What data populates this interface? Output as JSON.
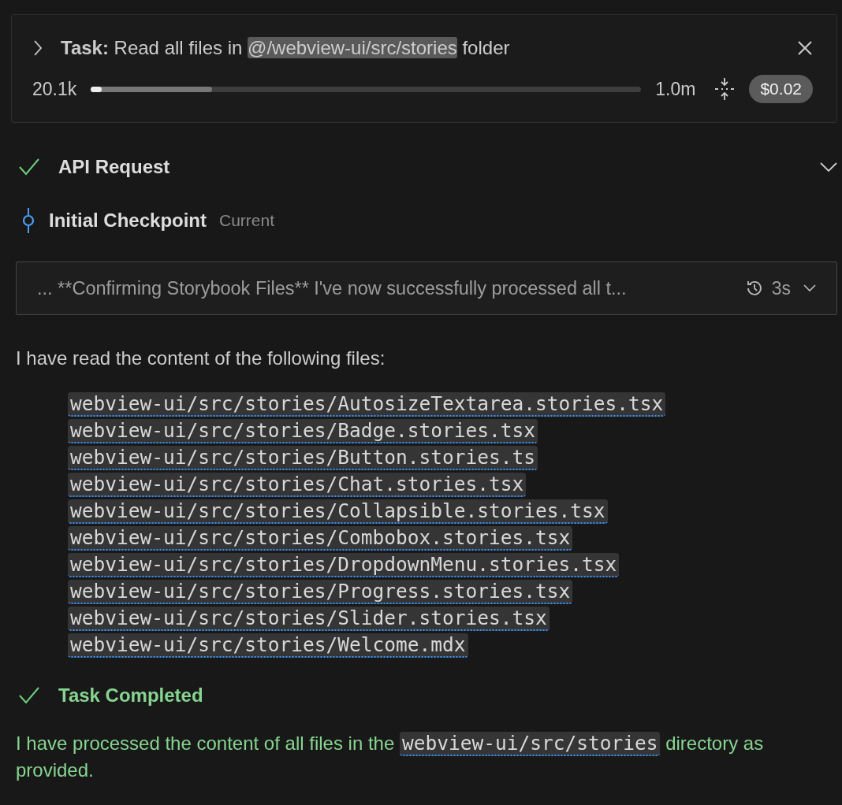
{
  "task": {
    "expanded": false,
    "label": "Task:",
    "before": "Read all files in ",
    "mention": "@/webview-ui/src/stories",
    "after": " folder",
    "tokens": "20.1k",
    "context_bar": {
      "level": 0.02,
      "buffer": {
        "level": 0.22
      }
    },
    "context_window": "1.0m",
    "cost": "$0.02"
  },
  "api_request": {
    "title": "API Request",
    "done": true,
    "expanded": false
  },
  "checkpoint": {
    "title": "Initial Checkpoint",
    "status": "Current"
  },
  "thinking": {
    "text": "... **Confirming Storybook Files** I've now successfully processed all t...",
    "duration": "3s",
    "expanded": false
  },
  "intro": "I have read the content of the following files:",
  "files": [
    "webview-ui/src/stories/AutosizeTextarea.stories.tsx",
    "webview-ui/src/stories/Badge.stories.tsx",
    "webview-ui/src/stories/Button.stories.ts",
    "webview-ui/src/stories/Chat.stories.tsx",
    "webview-ui/src/stories/Collapsible.stories.tsx",
    "webview-ui/src/stories/Combobox.stories.tsx",
    "webview-ui/src/stories/DropdownMenu.stories.tsx",
    "webview-ui/src/stories/Progress.stories.tsx",
    "webview-ui/src/stories/Slider.stories.tsx",
    "webview-ui/src/stories/Welcome.mdx"
  ],
  "completion": {
    "title": "Task Completed",
    "done": true,
    "before": "I have processed the content of all files in the ",
    "link": "webview-ui/src/stories",
    "after": " directory as provided."
  }
}
